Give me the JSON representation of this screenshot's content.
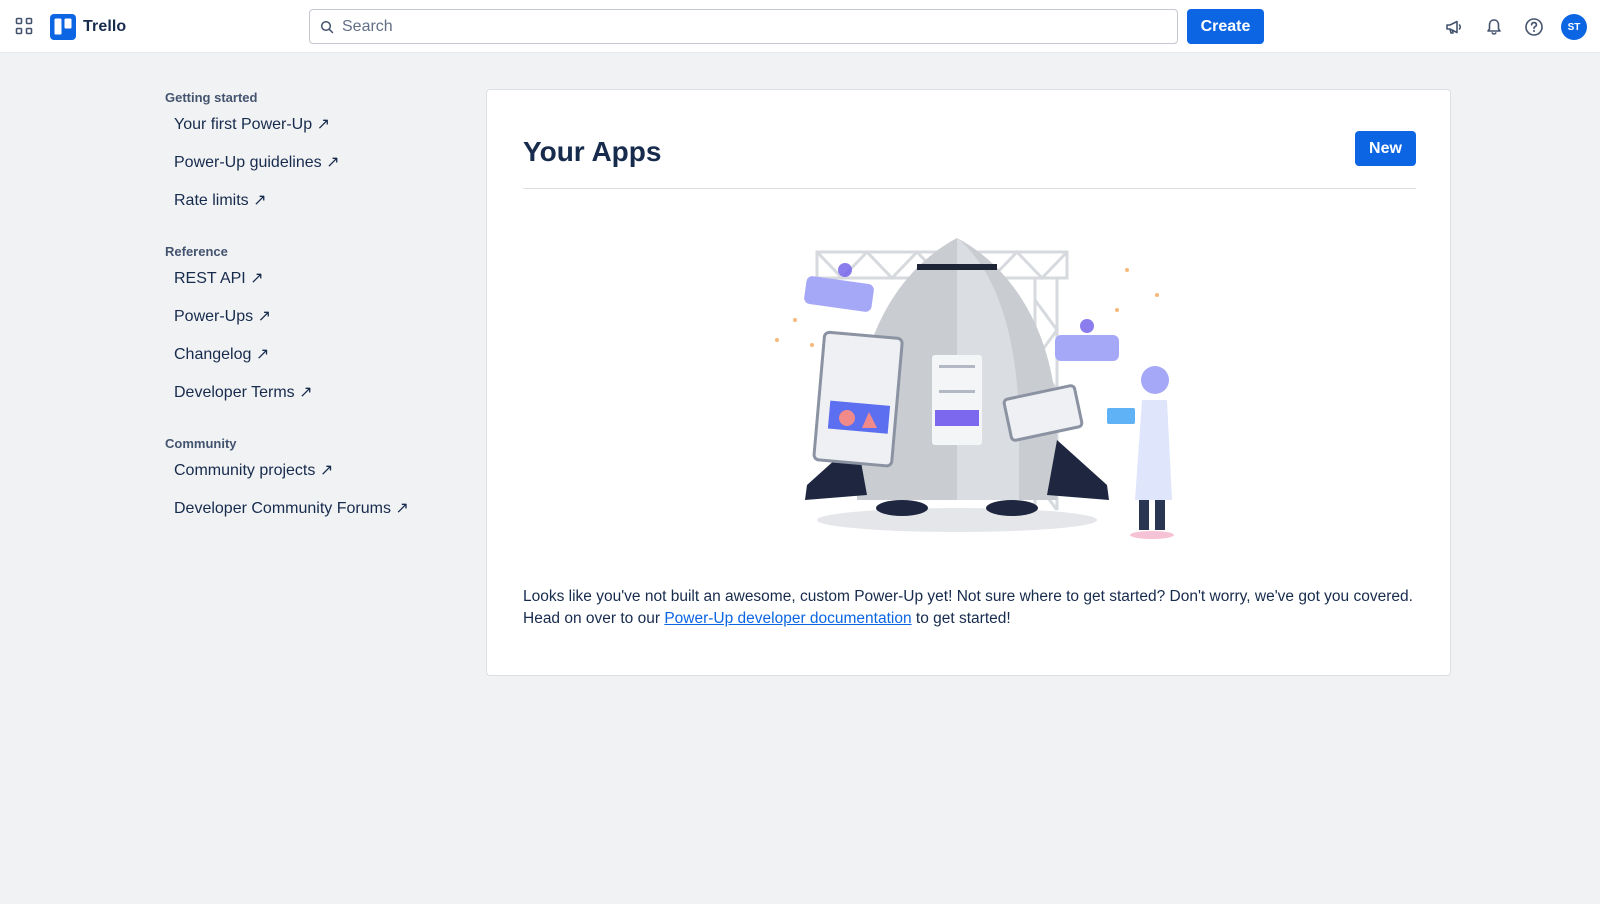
{
  "header": {
    "app_name": "Trello",
    "search_placeholder": "Search",
    "create_label": "Create",
    "avatar_initials": "ST",
    "icons": [
      "apps-grid-icon",
      "megaphone-icon",
      "bell-icon",
      "help-icon"
    ]
  },
  "sidebar": {
    "sections": [
      {
        "title": "Getting started",
        "links": [
          "Your first Power-Up ↗",
          "Power-Up guidelines ↗",
          "Rate limits ↗"
        ]
      },
      {
        "title": "Reference",
        "links": [
          "REST API ↗",
          "Power-Ups ↗",
          "Changelog ↗",
          "Developer Terms ↗"
        ]
      },
      {
        "title": "Community",
        "links": [
          "Community projects ↗",
          "Developer Community Forums ↗"
        ]
      }
    ]
  },
  "main": {
    "title": "Your Apps",
    "new_label": "New",
    "empty_text_before": "Looks like you've not built an awesome, custom Power-Up yet! Not sure where to get started? Don't worry, we've got you covered. Head on over to our ",
    "empty_link": "Power-Up developer documentation",
    "empty_text_after": " to get started!"
  },
  "colors": {
    "accent": "#0c66e4",
    "background": "#f1f2f4",
    "text": "#172b4d"
  }
}
